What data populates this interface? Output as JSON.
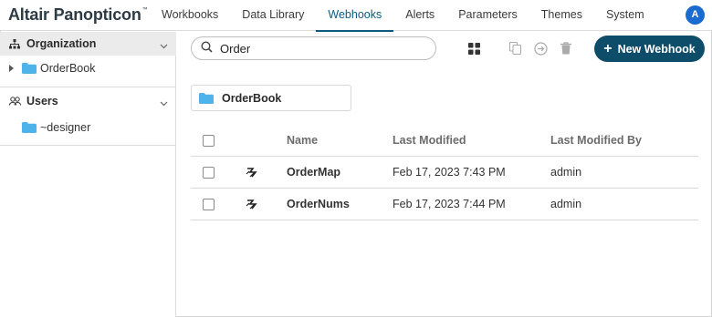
{
  "app": {
    "title": "Altair Panopticon",
    "trademark": "™"
  },
  "nav": {
    "tabs": [
      {
        "label": "Workbooks",
        "active": false
      },
      {
        "label": "Data Library",
        "active": false
      },
      {
        "label": "Webhooks",
        "active": true
      },
      {
        "label": "Alerts",
        "active": false
      },
      {
        "label": "Parameters",
        "active": false
      },
      {
        "label": "Themes",
        "active": false
      },
      {
        "label": "System",
        "active": false
      }
    ],
    "avatar_initial": "A"
  },
  "sidebar": {
    "organization": {
      "label": "Organization",
      "icon": "org-tree-icon",
      "items": [
        {
          "label": "OrderBook",
          "icon": "folder-icon"
        }
      ]
    },
    "users": {
      "label": "Users",
      "icon": "users-icon",
      "items": [
        {
          "label": "~designer",
          "icon": "folder-icon"
        }
      ]
    }
  },
  "toolbar": {
    "search_value": "Order",
    "search_placeholder": "Search",
    "new_button_label": "New Webhook",
    "icons": [
      "grid-view-icon",
      "copy-icon",
      "move-icon",
      "delete-icon"
    ]
  },
  "folder_card": {
    "label": "OrderBook"
  },
  "table": {
    "columns": [
      "Name",
      "Last Modified",
      "Last Modified By"
    ],
    "rows": [
      {
        "name": "OrderMap",
        "modified": "Feb 17, 2023 7:43 PM",
        "by": "admin"
      },
      {
        "name": "OrderNums",
        "modified": "Feb 17, 2023 7:44 PM",
        "by": "admin"
      }
    ]
  },
  "colors": {
    "accent": "#0c5a7e",
    "primary_button": "#0e4d69",
    "avatar": "#1a6bd0",
    "folder": "#4db3ea"
  }
}
